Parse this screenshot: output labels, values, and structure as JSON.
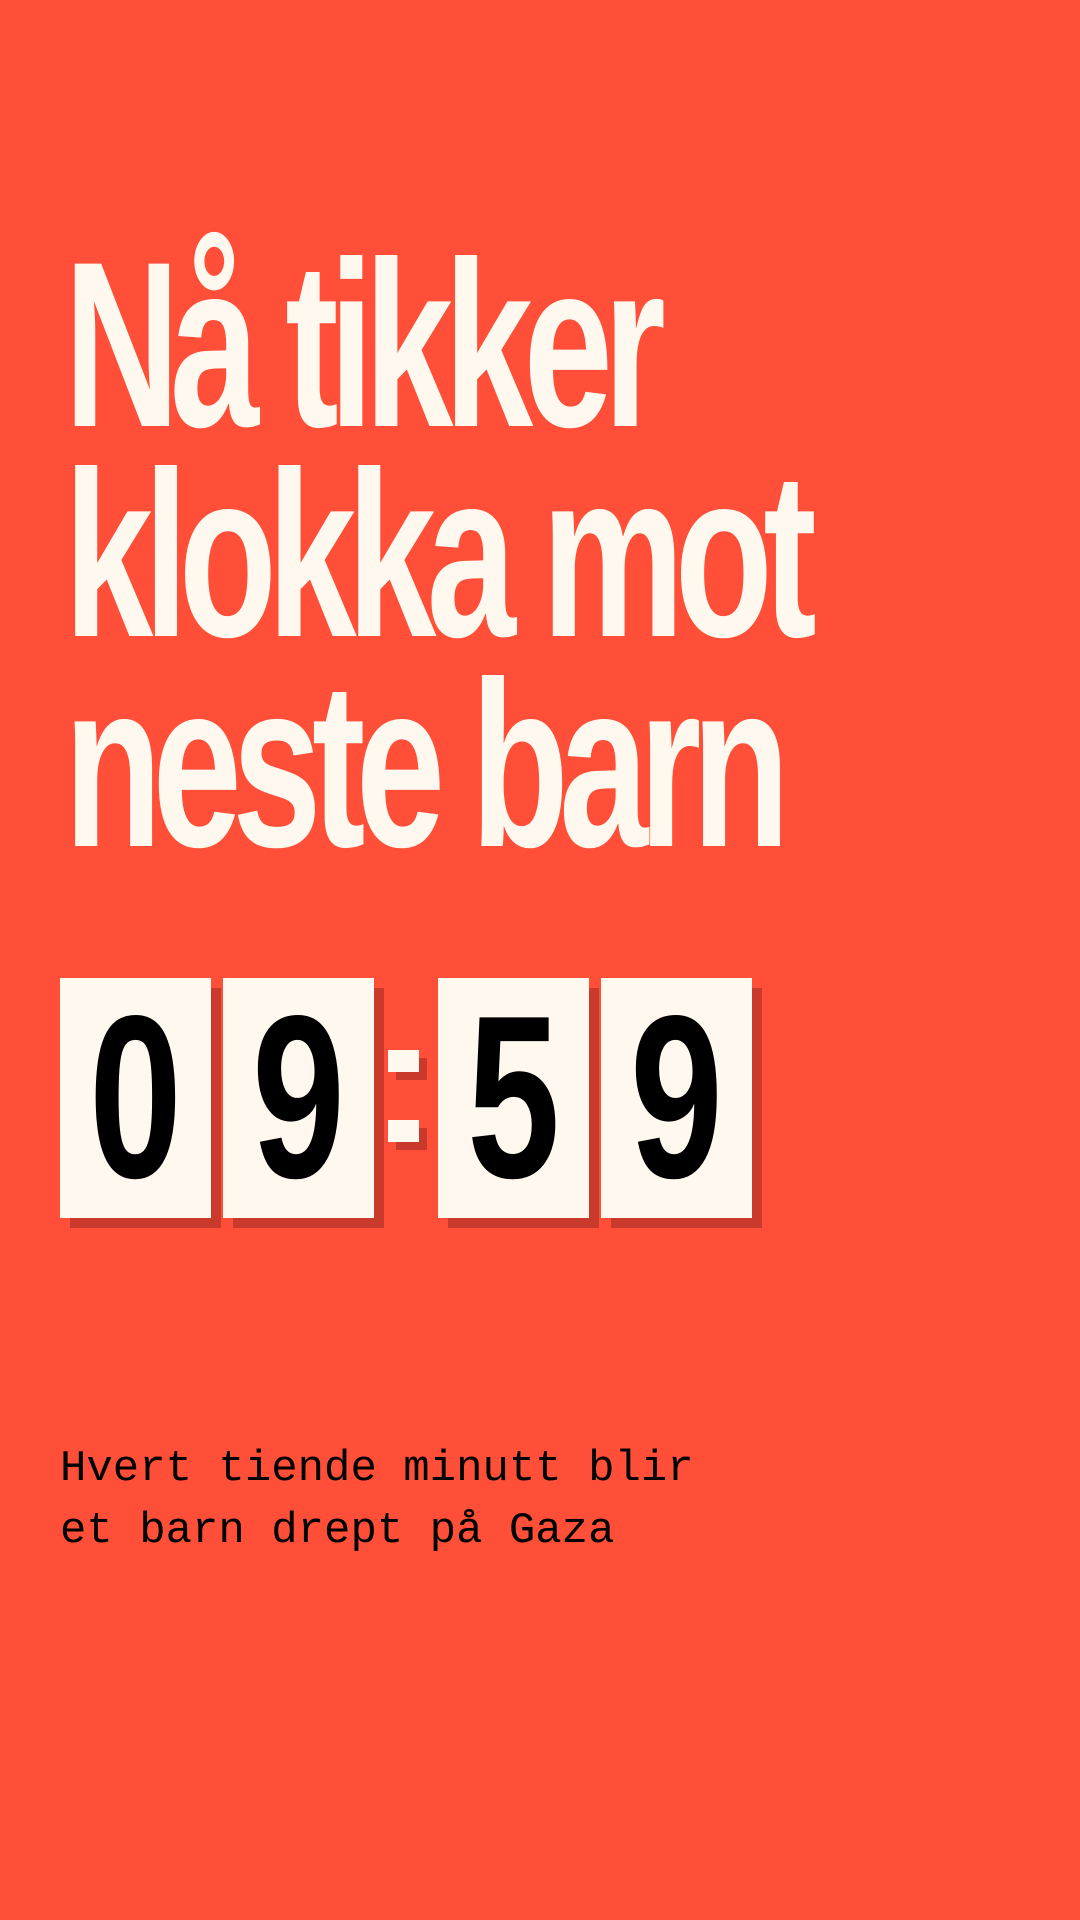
{
  "headline": {
    "lines": [
      "Nå tikker",
      "klokka mot",
      "neste barn"
    ]
  },
  "timer": {
    "digits": [
      "0",
      "9",
      "5",
      "9"
    ],
    "separator": ":"
  },
  "subtitle": {
    "lines": [
      "Hvert tiende minutt blir",
      "et barn drept på Gaza"
    ]
  },
  "colors": {
    "background": "#ff4f38",
    "headline_text": "#fff8ef",
    "digit_card": "#fff8ef",
    "digit_shadow": "#c93a2c",
    "digit_text": "#000000",
    "subtitle_text": "#000000"
  }
}
